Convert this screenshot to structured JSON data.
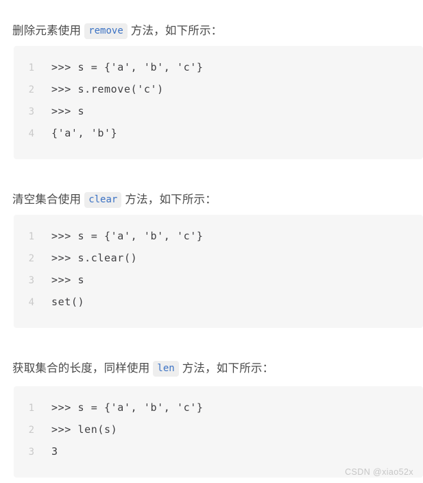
{
  "page": {
    "background": "#ffffff",
    "text_color": "#4a4a4a",
    "code_block_bg": "#f6f6f6",
    "inline_code_bg": "#eeeeee",
    "inline_code_color": "#3b72c4",
    "line_number_color": "#c9c9c9"
  },
  "sections": [
    {
      "paragraph": {
        "before": "删除元素使用",
        "code": "remove",
        "after": "方法，如下所示："
      },
      "code_block": {
        "lines": [
          {
            "number": "1",
            "text": ">>> s = {'a', 'b', 'c'}"
          },
          {
            "number": "2",
            "text": ">>> s.remove('c')"
          },
          {
            "number": "3",
            "text": ">>> s"
          },
          {
            "number": "4",
            "text": "{'a', 'b'}"
          }
        ]
      }
    },
    {
      "paragraph": {
        "before": "清空集合使用",
        "code": "clear",
        "after": "方法，如下所示："
      },
      "code_block": {
        "lines": [
          {
            "number": "1",
            "text": ">>> s = {'a', 'b', 'c'}"
          },
          {
            "number": "2",
            "text": ">>> s.clear()"
          },
          {
            "number": "3",
            "text": ">>> s"
          },
          {
            "number": "4",
            "text": "set()"
          }
        ]
      }
    },
    {
      "paragraph": {
        "before": "获取集合的长度，同样使用",
        "code": "len",
        "after": "方法，如下所示："
      },
      "code_block": {
        "lines": [
          {
            "number": "1",
            "text": ">>> s = {'a', 'b', 'c'}"
          },
          {
            "number": "2",
            "text": ">>> len(s)"
          },
          {
            "number": "3",
            "text": "3"
          }
        ]
      }
    }
  ],
  "watermark": {
    "text": "CSDN @xiao52x"
  }
}
